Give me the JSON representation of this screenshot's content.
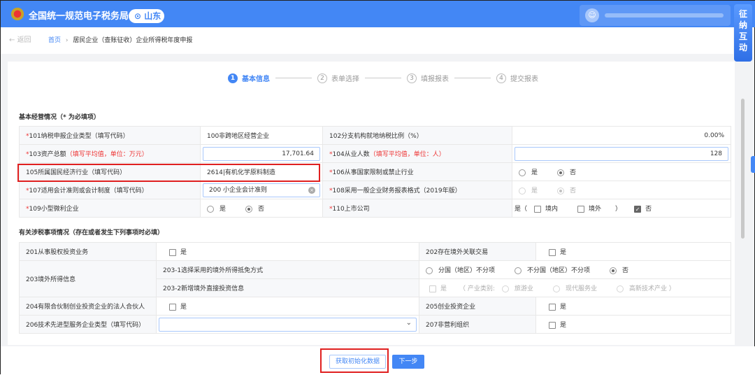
{
  "header": {
    "site_title": "全国统一规范电子税务局",
    "location": "山东",
    "side_button": "征纳互动"
  },
  "breadcrumb": {
    "back": "返回",
    "home": "首页",
    "separator": "›",
    "current": "居民企业（查账征收）企业所得税年度申报"
  },
  "steps": [
    {
      "num": "1",
      "label": "基本信息"
    },
    {
      "num": "2",
      "label": "表单选择"
    },
    {
      "num": "3",
      "label": "填报报表"
    },
    {
      "num": "4",
      "label": "提交报表"
    }
  ],
  "basic": {
    "title": "基本经营情况（* 为必填项）",
    "r101": {
      "label": "101纳税申报企业类型（填写代码）",
      "value": "100非跨地区经营企业"
    },
    "r102": {
      "label": "102分支机构就地纳税比例（%）",
      "value": "0.00%"
    },
    "r103": {
      "label": "103资产总额",
      "hint": "（填写平均值，单位：万元）",
      "value": "17,701.64"
    },
    "r104": {
      "label": "104从业人数",
      "hint": "（填写平均值，单位：人）",
      "value": "128"
    },
    "r105": {
      "label": "105所属国民经济行业（填写代码）",
      "value": "2614|有机化学原料制造"
    },
    "r106": {
      "label": "106从事国家限制或禁止行业",
      "yes": "是",
      "no": "否"
    },
    "r107": {
      "label": "107适用会计准则或会计制度（填写代码）",
      "value": "200 小企业会计准则"
    },
    "r108": {
      "label": "108采用一般企业财务报表格式（2019年版）",
      "yes": "是",
      "no": "否"
    },
    "r109": {
      "label": "109小型微利企业",
      "yes": "是",
      "no": "否"
    },
    "r110": {
      "label": "110上市公司",
      "yes_open": "是（",
      "domestic": "境内",
      "overseas": "境外",
      "close": "）",
      "no": "否"
    }
  },
  "tax": {
    "title": "有关涉税事项情况（存在或者发生下列事项时必填）",
    "r201": {
      "label": "201从事股权投资业务",
      "yes": "是"
    },
    "r202": {
      "label": "202存在境外关联交易",
      "yes": "是"
    },
    "r203": {
      "label": "203境外所得信息",
      "sub1": "203-1选择采用的境外所得抵免方式",
      "opt1": "分国（地区）不分项",
      "opt2": "不分国（地区）不分项",
      "opt3": "否",
      "sub2": "203-2新增境外直接投资信息",
      "yes": "是",
      "industry": "（ 产业类别:",
      "ind1": "旅游业",
      "ind2": "现代服务业",
      "ind3": "高新技术产业 ）"
    },
    "r204": {
      "label": "204有限合伙制创业投资企业的法人合伙人",
      "yes": "是"
    },
    "r205": {
      "label": "205创业投资企业",
      "yes": "是"
    },
    "r206": {
      "label": "206技术先进型服务企业类型（填写代码）",
      "value": ""
    },
    "r207": {
      "label": "207非营利组织",
      "yes": "是"
    }
  },
  "footer": {
    "init_button": "获取初始化数据",
    "next_button": "下一步"
  },
  "colors": {
    "brand": "#4387f5",
    "highlight": "#e02020",
    "required": "#e33333"
  }
}
